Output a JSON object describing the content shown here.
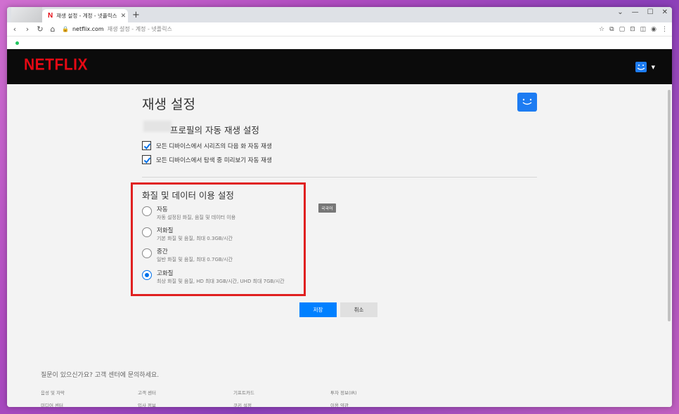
{
  "browser": {
    "tab_title": "재생 설정 - 계정 - 넷플릭스",
    "tab_favicon": "N",
    "url_host": "netflix.com",
    "url_path": "재생 설정 - 계정 - 넷플릭스"
  },
  "header": {
    "logo": "NETFLIX"
  },
  "page": {
    "title": "재생 설정",
    "profile_section_title": "프로필의 자동 재생 설정",
    "autoplay_options": [
      {
        "label": "모든 디바이스에서 시리즈의 다음 화 자동 재생",
        "checked": true
      },
      {
        "label": "모든 디바이스에서 탐색 중 미리보기 자동 재생",
        "checked": true
      }
    ],
    "quality_title": "화질 및 데이터 이용 설정",
    "quality_options": [
      {
        "label": "자동",
        "desc": "자동 설정된 화질, 음질 및 데이터 이용",
        "selected": false
      },
      {
        "label": "저화질",
        "desc": "기본 화질 및 음질, 최대 0.3GB/시간",
        "selected": false
      },
      {
        "label": "중간",
        "desc": "일반 화질 및 음질, 최대 0.7GB/시간",
        "selected": false
      },
      {
        "label": "고화질",
        "desc": "최상 화질 및 음질, HD 최대 3GB/시간, UHD 최대 7GB/시간",
        "selected": true
      }
    ],
    "lang_badge": "국국어",
    "save_label": "저장",
    "cancel_label": "취소"
  },
  "footer": {
    "question": "질문이 있으신가요? 고객 센터에 문의하세요.",
    "links": [
      "음성 및 자막",
      "고객 센터",
      "기프트카드",
      "투자 정보(IR)",
      "미디어 센터",
      "입사 정보",
      "쿠키 설정",
      "이용 약관"
    ]
  },
  "colors": {
    "netflix_red": "#e50914",
    "accent_blue": "#0071eb",
    "highlight_red": "#e02020"
  },
  "icons": [
    "back-icon",
    "forward-icon",
    "reload-icon",
    "lock-icon",
    "bookmark-star-icon",
    "extension-icon",
    "profile-icon",
    "menu-icon",
    "smiley-avatar-icon",
    "checkmark-icon"
  ]
}
